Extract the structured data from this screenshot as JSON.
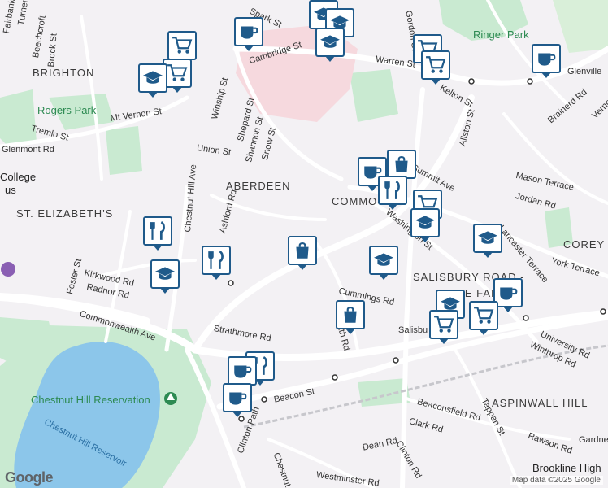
{
  "labels": {
    "neighborhoods": [
      "BRIGHTON",
      "ABERDEEN",
      "COMMO",
      "ST. ELIZABETH'S",
      "SALISBURY ROAD -",
      "CORE FARM",
      "ASPINWALL HILL",
      "COREY H"
    ],
    "parks": [
      "Ringer Park",
      "Rogers Park",
      "Chestnut Hill Reservation"
    ],
    "water": [
      "Chestnut Hill Reservoir"
    ],
    "places": [
      "College",
      "us",
      "Brookline High"
    ],
    "streets": [
      "Fairbanks",
      "Turner",
      "Beechcroft",
      "Brock St",
      "Spark St",
      "Cambridge St",
      "Warren St",
      "Kelton St",
      "Brainerd Rd",
      "Glenville",
      "Mt Vernon St",
      "Tremlo St",
      "Glenmont Rd",
      "Winship St",
      "Shepard St",
      "Shannon St",
      "Union St",
      "Snow St",
      "Summit Ave",
      "Mason Terrace",
      "Jordan Rd",
      "Allston St",
      "Washington St",
      "Chestnut Hill Ave",
      "Foster St",
      "Kirkwood Rd",
      "Radnor Rd",
      "Commonwealth Ave",
      "Strathmore Rd",
      "Cummings Rd",
      "Beacon St",
      "York Terrace",
      "Lancaster Terrace",
      "Winthrop Rd",
      "University Rd",
      "Beaconsfield Rd",
      "Clark Rd",
      "Tappan St",
      "Rawson Rd",
      "Dean Rd",
      "Clinton Rd",
      "Clinton Path",
      "Chestnut",
      "Salisbu",
      "Gardner",
      "ath Rd",
      "Westminster Rd",
      "Ashford Rd",
      "Gordon St",
      "Vernon"
    ]
  },
  "pins": [
    {
      "name": "education-pin",
      "icon": "graduation-cap-icon"
    },
    {
      "name": "cafe-pin",
      "icon": "coffee-cup-icon"
    },
    {
      "name": "grocery-pin",
      "icon": "shopping-cart-icon"
    },
    {
      "name": "restaurant-pin",
      "icon": "fork-knife-icon"
    },
    {
      "name": "shopping-pin",
      "icon": "shopping-bag-icon"
    }
  ],
  "footer": {
    "google_logo": "Google",
    "attribution": "Map data ©2025 Google"
  },
  "colors": {
    "pin_border": "#1f5a8a",
    "park_green": "#c9ead1",
    "water_blue": "#8cc6ea",
    "campus_pink": "#f6d9de",
    "road_white": "#ffffff"
  }
}
